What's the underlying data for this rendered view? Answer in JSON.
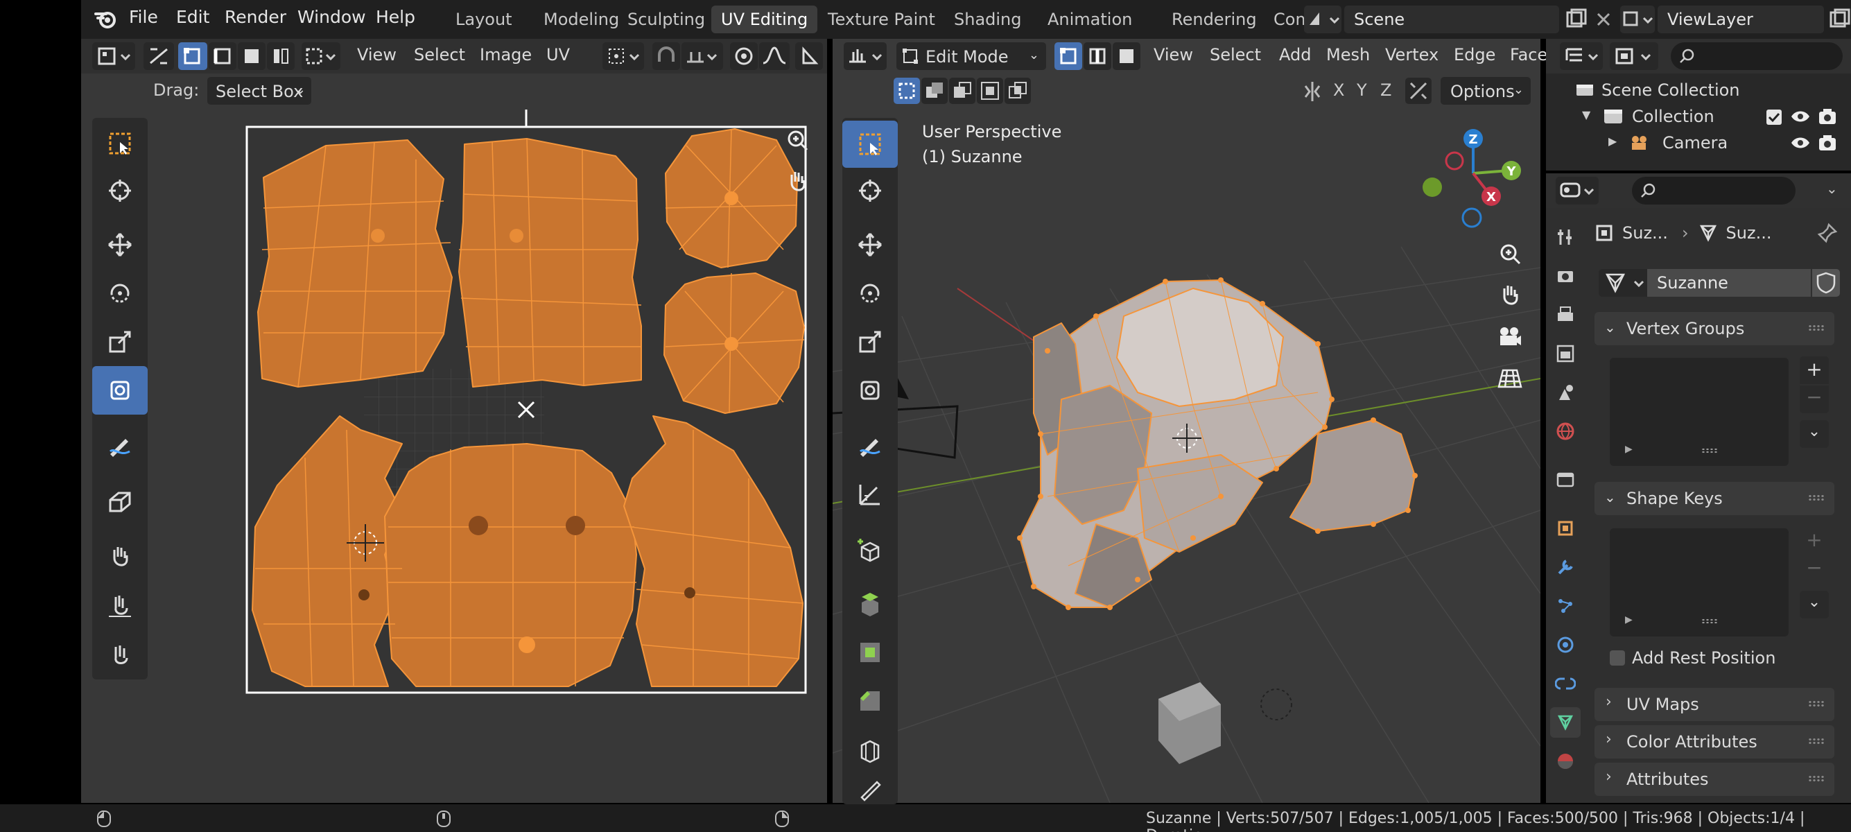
{
  "menu": [
    "File",
    "Edit",
    "Render",
    "Window",
    "Help"
  ],
  "workspaces": [
    "Layout",
    "Modeling",
    "Sculpting",
    "UV Editing",
    "Texture Paint",
    "Shading",
    "Animation",
    "Rendering",
    "Comp"
  ],
  "scene_name": "Scene",
  "view_layer": "ViewLayer",
  "uv_editor": {
    "header_menus": [
      "View",
      "Select",
      "Image",
      "UV"
    ],
    "drag_label": "Drag:",
    "drag_value": "Select Box"
  },
  "viewport": {
    "mode": "Edit Mode",
    "header_menus": [
      "View",
      "Select",
      "Add",
      "Mesh",
      "Vertex",
      "Edge",
      "Face"
    ],
    "axes": [
      "X",
      "Y",
      "Z"
    ],
    "options_label": "Options",
    "overlay_line1": "User Perspective",
    "overlay_line2": "(1) Suzanne",
    "gizmo_axes": [
      "Z",
      "Y",
      "X"
    ]
  },
  "outliner": {
    "items": [
      {
        "label": "Scene Collection"
      },
      {
        "label": "Collection"
      },
      {
        "label": "Camera"
      }
    ]
  },
  "properties": {
    "breadcrumb_object": "Suz...",
    "breadcrumb_mesh": "Suz...",
    "mesh_name": "Suzanne",
    "panels": {
      "vertex_groups": "Vertex Groups",
      "shape_keys": "Shape Keys",
      "add_rest_position": "Add Rest Position",
      "uv_maps": "UV Maps",
      "color_attributes": "Color Attributes",
      "attributes": "Attributes"
    }
  },
  "status": "Suzanne | Verts:507/507 | Edges:1,005/1,005 | Faces:500/500 | Tris:968 | Objects:1/4 | Duratic",
  "colors": {
    "accent_blue": "#4772b3",
    "selection_orange": "#f5953a",
    "uv_fill": "#c9752f"
  }
}
